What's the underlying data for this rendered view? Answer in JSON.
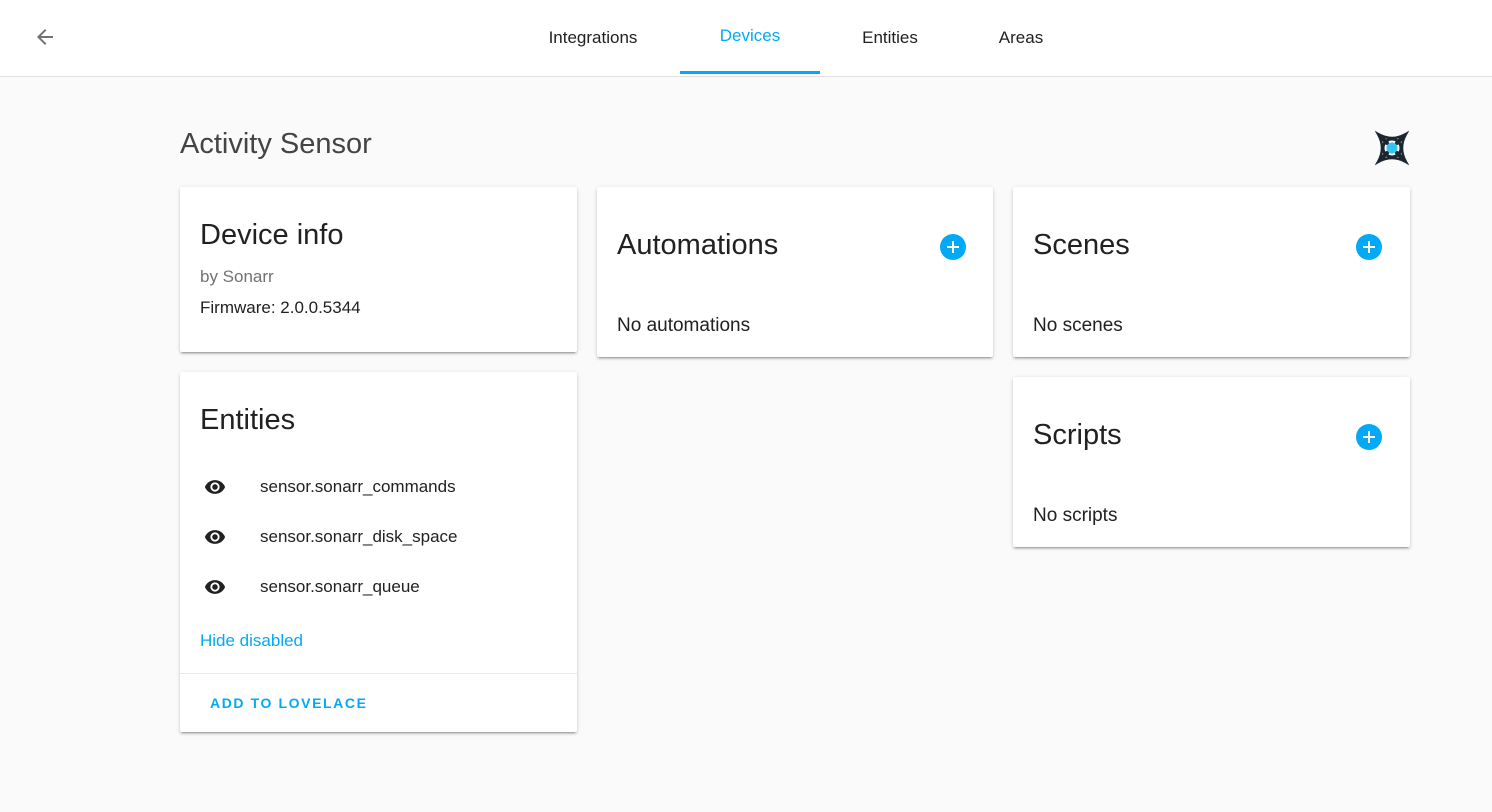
{
  "header": {
    "tabs": [
      {
        "label": "Integrations",
        "active": false
      },
      {
        "label": "Devices",
        "active": true
      },
      {
        "label": "Entities",
        "active": false
      },
      {
        "label": "Areas",
        "active": false
      }
    ],
    "back_icon": "arrow-left-icon"
  },
  "page": {
    "title": "Activity Sensor",
    "brand_icon": "sonarr-logo-icon"
  },
  "device_info": {
    "title": "Device info",
    "by_line": "by Sonarr",
    "firmware": "Firmware: 2.0.0.5344"
  },
  "entities": {
    "title": "Entities",
    "items": [
      {
        "entity_id": "sensor.sonarr_commands",
        "icon": "eye-icon"
      },
      {
        "entity_id": "sensor.sonarr_disk_space",
        "icon": "eye-icon"
      },
      {
        "entity_id": "sensor.sonarr_queue",
        "icon": "eye-icon"
      }
    ],
    "hide_disabled_label": "Hide disabled",
    "add_to_lovelace_label": "ADD TO LOVELACE"
  },
  "automations": {
    "title": "Automations",
    "empty_text": "No automations",
    "add_icon": "plus-circle-icon"
  },
  "scenes": {
    "title": "Scenes",
    "empty_text": "No scenes",
    "add_icon": "plus-circle-icon"
  },
  "scripts": {
    "title": "Scripts",
    "empty_text": "No scripts",
    "add_icon": "plus-circle-icon"
  },
  "colors": {
    "accent": "#03a9f4",
    "text": "#212121",
    "secondary_text": "#727272",
    "background": "#fafafa"
  }
}
